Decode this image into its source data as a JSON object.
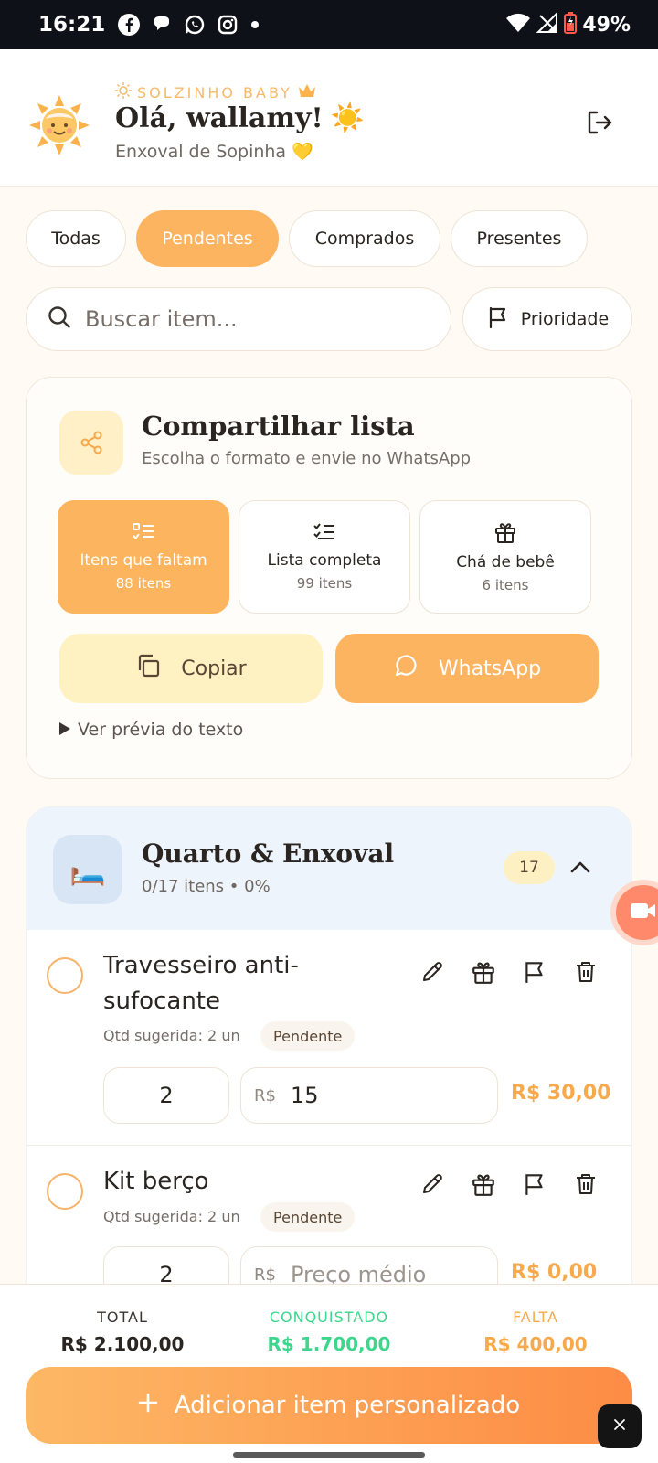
{
  "status_bar": {
    "time": "16:21",
    "battery": "49%"
  },
  "header": {
    "brand": "SOLZINHO BABY",
    "greeting": "Olá, wallamy!",
    "subtitle": "Enxoval de Sopinha",
    "greeting_emoji": "☀️",
    "subtitle_emoji": "💛"
  },
  "tabs": [
    {
      "label": "Todas",
      "active": false
    },
    {
      "label": "Pendentes",
      "active": true
    },
    {
      "label": "Comprados",
      "active": false
    },
    {
      "label": "Presentes",
      "active": false
    }
  ],
  "search": {
    "placeholder": "Buscar item..."
  },
  "priority_button": {
    "label": "Prioridade"
  },
  "share": {
    "title": "Compartilhar lista",
    "subtitle": "Escolha o formato e envie no WhatsApp",
    "options": [
      {
        "label": "Itens que faltam",
        "count": "88 itens",
        "icon": "list-pending-icon",
        "active": true
      },
      {
        "label": "Lista completa",
        "count": "99 itens",
        "icon": "list-check-icon",
        "active": false
      },
      {
        "label": "Chá de bebê",
        "count": "6 itens",
        "icon": "gift-icon",
        "active": false
      }
    ],
    "copy_label": "Copiar",
    "whatsapp_label": "WhatsApp",
    "preview_label": "Ver prévia do texto"
  },
  "category": {
    "title": "Quarto & Enxoval",
    "subtitle": "0/17 itens • 0%",
    "badge": "17",
    "icon": "🛏️",
    "items": [
      {
        "name": "Travesseiro anti-sufocante",
        "suggested": "Qtd sugerida: 2 un",
        "status": "Pendente",
        "qty": "2",
        "currency": "R$",
        "price": "15",
        "price_placeholder": "Preço médio",
        "total": "R$ 30,00"
      },
      {
        "name": "Kit berço",
        "suggested": "Qtd sugerida: 2 un",
        "status": "Pendente",
        "qty": "2",
        "currency": "R$",
        "price": "",
        "price_placeholder": "Preço médio",
        "total": "R$ 0,00"
      }
    ]
  },
  "summary": {
    "total_label": "TOTAL",
    "total_value": "R$ 2.100,00",
    "achieved_label": "CONQUISTADO",
    "achieved_value": "R$ 1.700,00",
    "missing_label": "FALTA",
    "missing_value": "R$ 400,00"
  },
  "add_button": {
    "label": "Adicionar item personalizado"
  },
  "colors": {
    "accent": "#fdb461",
    "success": "#3dd68c",
    "warning": "#f7a94b",
    "text": "#2a2521"
  }
}
